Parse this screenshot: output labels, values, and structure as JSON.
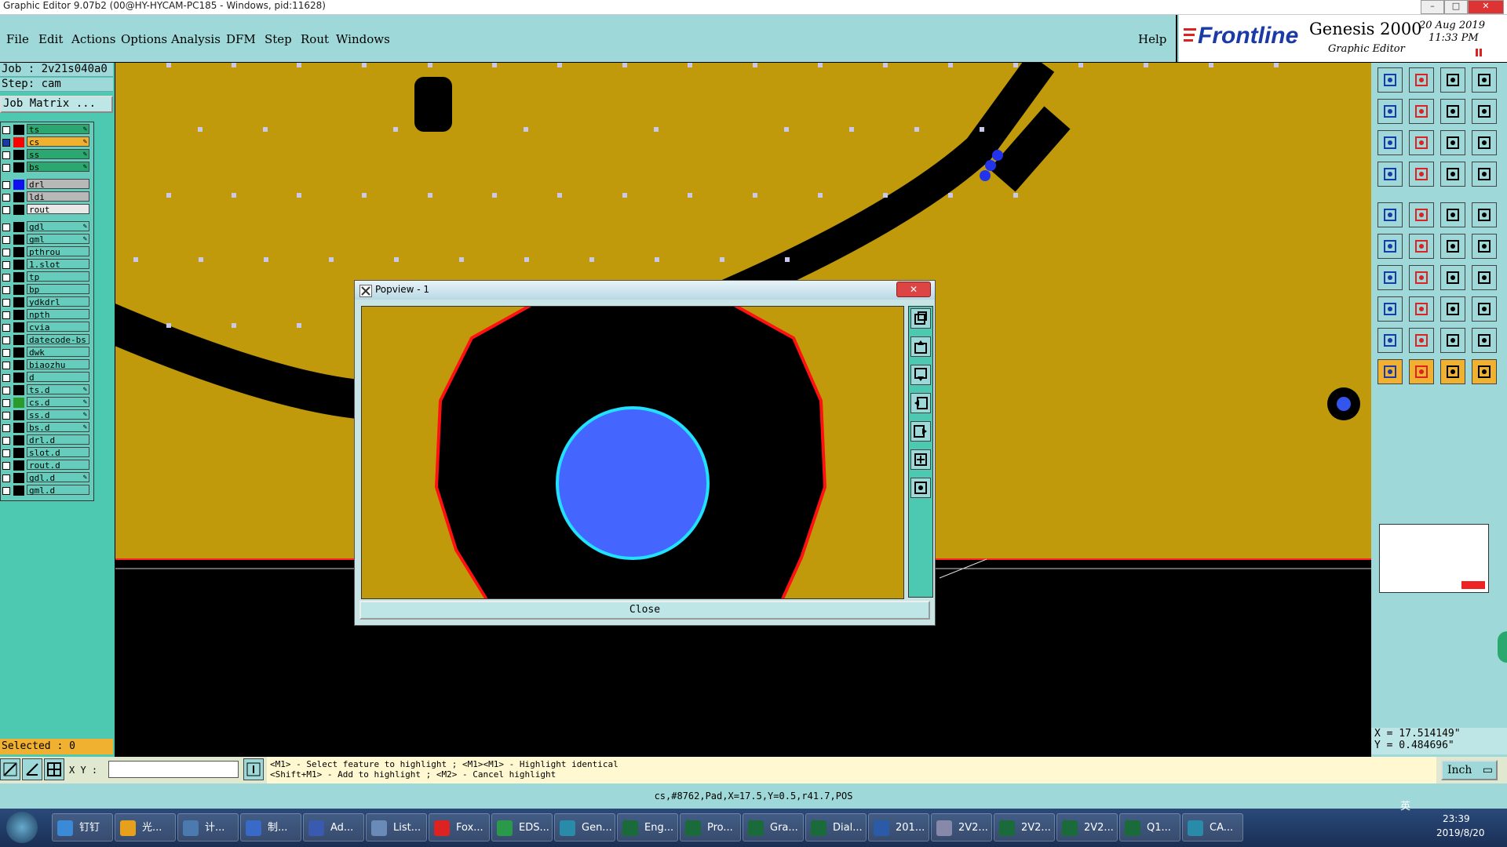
{
  "window": {
    "title": "Graphic Editor 9.07b2 (00@HY-HYCAM-PC185 - Windows, pid:11628)",
    "minimize": "–",
    "maximize": "□",
    "close": "✕"
  },
  "menu": {
    "items": [
      "File",
      "Edit",
      "Actions",
      "Options",
      "Analysis",
      "DFM",
      "Step",
      "Rout",
      "Windows"
    ],
    "help": "Help"
  },
  "brand": {
    "logo_text": "Frontline",
    "product": "Genesis 2000",
    "subtitle": "Graphic Editor",
    "date": "20  Aug 2019",
    "time": "11:33 PM",
    "accent": "#1a3aa8"
  },
  "job": {
    "job_label": "Job : 2v21s040a0",
    "step_label": "Step: cam",
    "matrix_button": "Job Matrix ..."
  },
  "layers": [
    {
      "name": "ts",
      "color": "#000000",
      "bg": "#2aa870",
      "edit": true
    },
    {
      "name": "cs",
      "color": "#ff0000",
      "bg": "#f0b030",
      "edit": true,
      "selected": true
    },
    {
      "name": "ss",
      "color": "#000000",
      "bg": "#2aa870",
      "edit": true
    },
    {
      "name": "bs",
      "color": "#000000",
      "bg": "#2aa870",
      "edit": true
    },
    {
      "name": "drl",
      "color": "#1010ee",
      "bg": "#b8b8b8",
      "edit": false,
      "gap": true
    },
    {
      "name": "ldi",
      "color": "#000000",
      "bg": "#b8b8b8",
      "edit": false
    },
    {
      "name": "rout",
      "color": "#000000",
      "bg": "#e8e8e8",
      "edit": false
    },
    {
      "name": "gdl",
      "color": "#000000",
      "bg": "#66ccbb",
      "edit": true,
      "gap": true
    },
    {
      "name": "gml",
      "color": "#000000",
      "bg": "#66ccbb",
      "edit": true
    },
    {
      "name": "pthrou",
      "color": "#000000",
      "bg": "#66ccbb",
      "edit": false
    },
    {
      "name": "1.slot",
      "color": "#000000",
      "bg": "#66ccbb",
      "edit": false
    },
    {
      "name": "tp",
      "color": "#000000",
      "bg": "#66ccbb",
      "edit": false
    },
    {
      "name": "bp",
      "color": "#000000",
      "bg": "#66ccbb",
      "edit": false
    },
    {
      "name": "ydkdrl",
      "color": "#000000",
      "bg": "#66ccbb",
      "edit": false
    },
    {
      "name": "npth",
      "color": "#000000",
      "bg": "#66ccbb",
      "edit": false
    },
    {
      "name": "cvia",
      "color": "#000000",
      "bg": "#66ccbb",
      "edit": false
    },
    {
      "name": "datecode-bs",
      "color": "#000000",
      "bg": "#66ccbb",
      "edit": false
    },
    {
      "name": "dwk",
      "color": "#000000",
      "bg": "#66ccbb",
      "edit": false
    },
    {
      "name": "biaozhu",
      "color": "#000000",
      "bg": "#66ccbb",
      "edit": false
    },
    {
      "name": "d",
      "color": "#000000",
      "bg": "#66ccbb",
      "edit": false
    },
    {
      "name": "ts.d",
      "color": "#000000",
      "bg": "#66ccbb",
      "edit": true
    },
    {
      "name": "cs.d",
      "color": "#2a9a2a",
      "bg": "#66ccbb",
      "edit": true
    },
    {
      "name": "ss.d",
      "color": "#000000",
      "bg": "#66ccbb",
      "edit": true
    },
    {
      "name": "bs.d",
      "color": "#000000",
      "bg": "#66ccbb",
      "edit": true
    },
    {
      "name": "drl.d",
      "color": "#000000",
      "bg": "#66ccbb",
      "edit": false
    },
    {
      "name": "slot.d",
      "color": "#000000",
      "bg": "#66ccbb",
      "edit": false
    },
    {
      "name": "rout.d",
      "color": "#000000",
      "bg": "#66ccbb",
      "edit": false
    },
    {
      "name": "gdl.d",
      "color": "#000000",
      "bg": "#66ccbb",
      "edit": true
    },
    {
      "name": "gml.d",
      "color": "#000000",
      "bg": "#66ccbb",
      "edit": false
    }
  ],
  "selected_label": "Selected : 0",
  "xy": {
    "label": "X Y :",
    "value": ""
  },
  "hints": {
    "line1": "<M1> - Select feature to highlight ; <M1><M1> - Highlight identical",
    "line2": "<Shift+M1> - Add to highlight ; <M2> - Cancel highlight"
  },
  "units": "Inch",
  "feature_info": "cs,#8762,Pad,X=17.5,Y=0.5,r41.7,POS",
  "coords": {
    "x": "X = 17.514149\"",
    "y": "Y = 0.484696\""
  },
  "popview": {
    "title": "Popview - 1",
    "close_label": "Close"
  },
  "colors": {
    "board": "#c09a0a",
    "copper": "#000000",
    "drill": "#4a6cff",
    "highlight": "#ff0000",
    "outline": "#22e0ff",
    "panel": "#9ed8d8"
  },
  "taskbar": {
    "tasks": [
      "钉钉",
      "光...",
      "计...",
      "制...",
      "Ad...",
      "List...",
      "Fox...",
      "EDS...",
      "Gen...",
      "Eng...",
      "Pro...",
      "Gra...",
      "Dial...",
      "201...",
      "2V2...",
      "2V2...",
      "2V2...",
      "Q1...",
      "CA..."
    ],
    "time": "23:39",
    "date": "2019/8/20",
    "ime": "英"
  }
}
